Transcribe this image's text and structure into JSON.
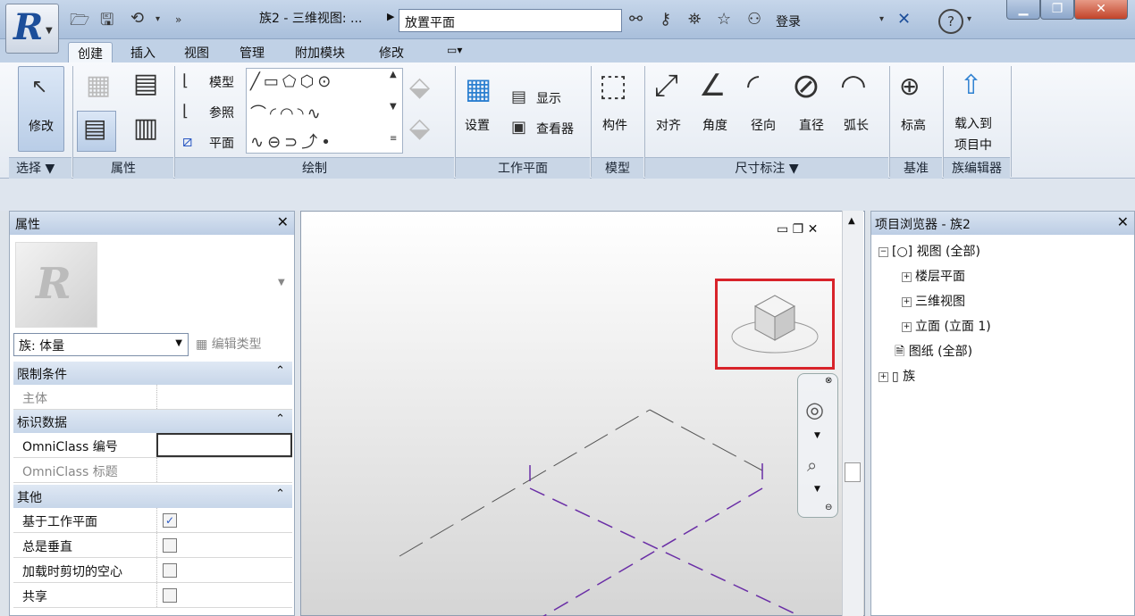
{
  "title_bar": {
    "title": "族2 - 三维视图: ...",
    "search_value": "放置平面",
    "login_label": "登录",
    "help_label": "?"
  },
  "tabs": [
    "创建",
    "插入",
    "视图",
    "管理",
    "附加模块",
    "修改"
  ],
  "ribbon": {
    "select": {
      "modify_label": "修改",
      "panel_label": "选择 ▼"
    },
    "properties": {
      "panel_label": "属性"
    },
    "draw": {
      "items": [
        "模型",
        "参照",
        "平面"
      ],
      "panel_label": "绘制"
    },
    "workplane": {
      "set_label": "设置",
      "show_label": "显示",
      "viewer_label": "查看器",
      "panel_label": "工作平面"
    },
    "model": {
      "component_label": "构件",
      "panel_label": "模型"
    },
    "dimension": {
      "items": [
        "对齐",
        "角度",
        "径向",
        "直径",
        "弧长"
      ],
      "panel_label": "尺寸标注 ▼"
    },
    "datum": {
      "level_label": "标高",
      "panel_label": "基准"
    },
    "family_editor": {
      "load_line1": "载入到",
      "load_line2": "项目中",
      "panel_label": "族编辑器"
    }
  },
  "properties_panel": {
    "title": "属性",
    "family_select": "族: 体量",
    "edit_type": "编辑类型",
    "groups": [
      {
        "name": "限制条件",
        "rows": [
          {
            "key": "主体",
            "value": "",
            "muted": true
          }
        ]
      },
      {
        "name": "标识数据",
        "rows": [
          {
            "key": "OmniClass 编号",
            "value": ""
          },
          {
            "key": "OmniClass 标题",
            "value": "",
            "muted": true
          }
        ]
      },
      {
        "name": "其他",
        "rows": [
          {
            "key": "基于工作平面",
            "checked": true
          },
          {
            "key": "总是垂直",
            "checked": false
          },
          {
            "key": "加载时剪切的空心",
            "checked": false
          },
          {
            "key": "共享",
            "checked": false
          }
        ]
      }
    ]
  },
  "project_browser": {
    "title": "项目浏览器 - 族2",
    "nodes": [
      {
        "label": "视图 (全部)",
        "level": 0,
        "toggle": "−"
      },
      {
        "label": "楼层平面",
        "level": 1,
        "toggle": "+"
      },
      {
        "label": "三维视图",
        "level": 1,
        "toggle": "+"
      },
      {
        "label": "立面 (立面 1)",
        "level": 1,
        "toggle": "+"
      },
      {
        "label": "图纸 (全部)",
        "level": 0,
        "toggle": ""
      },
      {
        "label": "族",
        "level": 0,
        "toggle": "+"
      }
    ]
  },
  "colors": {
    "accent": "#1c4e9a",
    "highlight": "#d8232a",
    "ref_plane": "#6a2ea6"
  }
}
